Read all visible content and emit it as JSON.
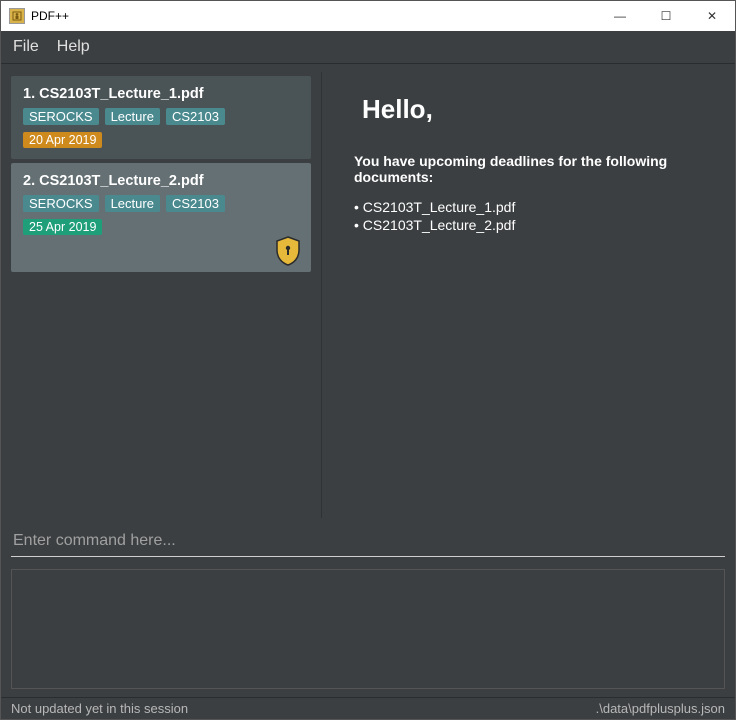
{
  "window": {
    "title": "PDF++"
  },
  "menu": {
    "file": "File",
    "help": "Help"
  },
  "sidebar": {
    "items": [
      {
        "index": "1.",
        "filename": "CS2103T_Lecture_1.pdf",
        "tags": [
          "SEROCKS",
          "Lecture",
          "CS2103"
        ],
        "date": "20 Apr 2019",
        "date_style": "orange",
        "selected": false,
        "locked": false
      },
      {
        "index": "2.",
        "filename": "CS2103T_Lecture_2.pdf",
        "tags": [
          "SEROCKS",
          "Lecture",
          "CS2103"
        ],
        "date": "25 Apr 2019",
        "date_style": "teal",
        "selected": true,
        "locked": true
      }
    ]
  },
  "content": {
    "greeting": "Hello,",
    "deadline_message": "You have upcoming deadlines for the following documents:",
    "deadline_docs": [
      "CS2103T_Lecture_1.pdf",
      "CS2103T_Lecture_2.pdf"
    ]
  },
  "command": {
    "placeholder": "Enter command here...",
    "value": ""
  },
  "status": {
    "left": "Not updated yet in this session",
    "right": ".\\data\\pdfplusplus.json"
  },
  "icons": {
    "app": "▣",
    "minimize": "—",
    "maximize": "☐",
    "close": "✕"
  }
}
